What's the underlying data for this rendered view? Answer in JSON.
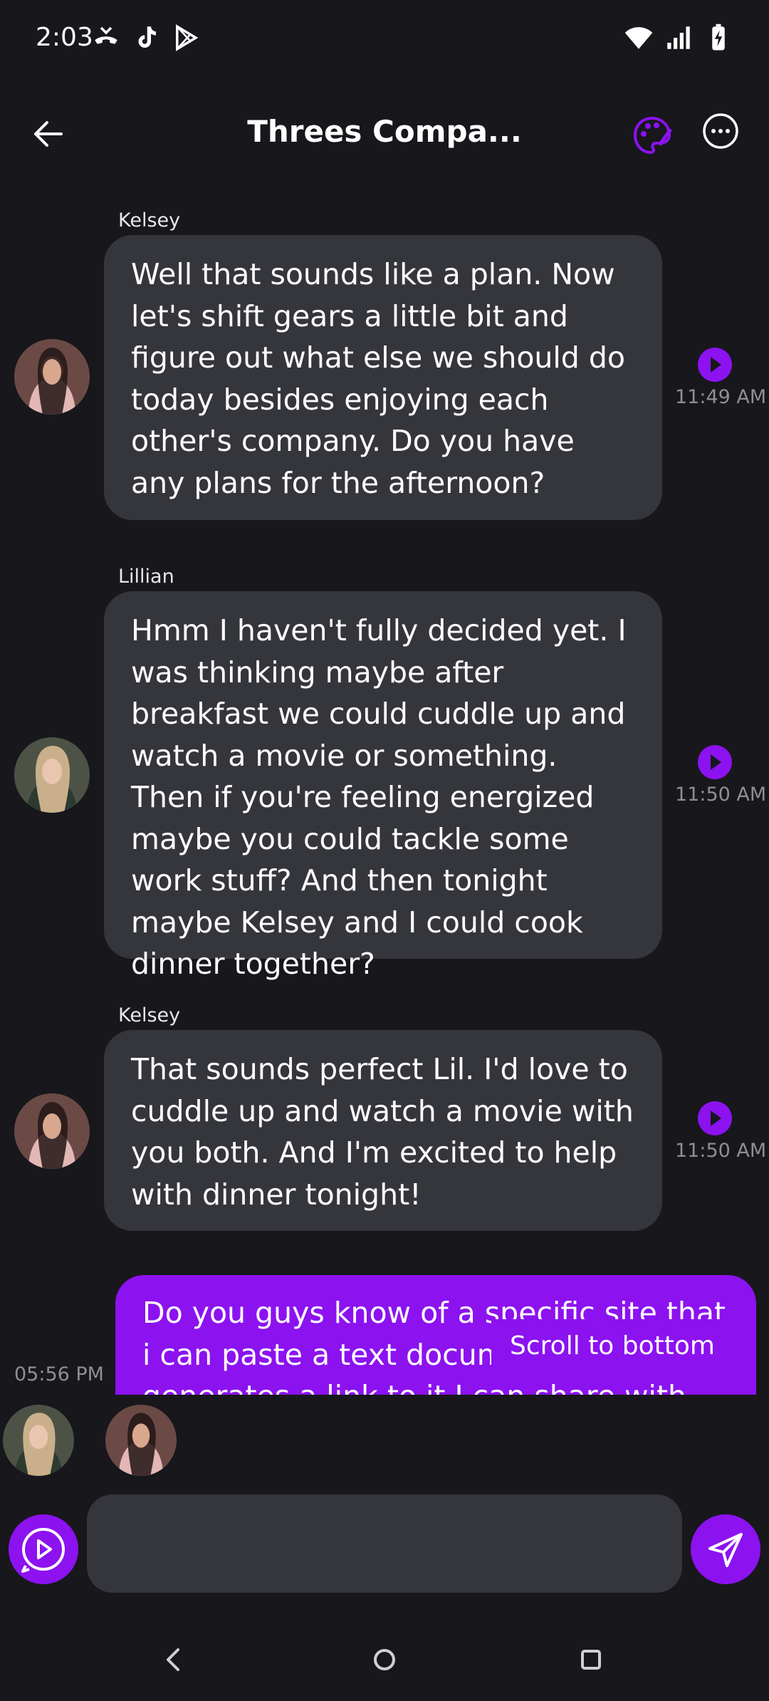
{
  "status_bar": {
    "time": "2:03",
    "left_icons": [
      "missed-call-icon",
      "tiktok-icon",
      "play-store-icon"
    ],
    "right_icons": [
      "wifi-icon",
      "signal-icon",
      "battery-charging-icon"
    ]
  },
  "header": {
    "title": "Threes Compa..."
  },
  "messages": [
    {
      "sender": "Kelsey",
      "text": "Well that sounds like a plan. Now let's shift gears a little bit and figure out what else we should do today besides enjoying each other's company. Do you have any plans for the afternoon?",
      "time": "11:49 AM"
    },
    {
      "sender": "Lillian",
      "text": "Hmm I haven't fully decided yet. I was thinking maybe after breakfast we could cuddle up and watch a movie or something. Then if you're feeling energized maybe you could tackle some work stuff? And then tonight maybe Kelsey and I could cook dinner together?",
      "time": "11:50 AM"
    },
    {
      "sender": "Kelsey",
      "text": "That sounds perfect Lil. I'd love to cuddle up and watch a movie with you both. And I'm excited to help with dinner tonight!",
      "time": "11:50 AM"
    }
  ],
  "my_message": {
    "text": "Do you guys know of a specific site that i can paste a text document to and it generates a link to it I can share with y'all that you",
    "time": "05:56 PM"
  },
  "scroll_button": "Scroll to bottom",
  "input": {
    "value": "",
    "placeholder": ""
  },
  "colors": {
    "background": "#17171c",
    "bubble": "#35363c",
    "accent": "#8c12f0",
    "timestamp": "#8e8f96"
  }
}
